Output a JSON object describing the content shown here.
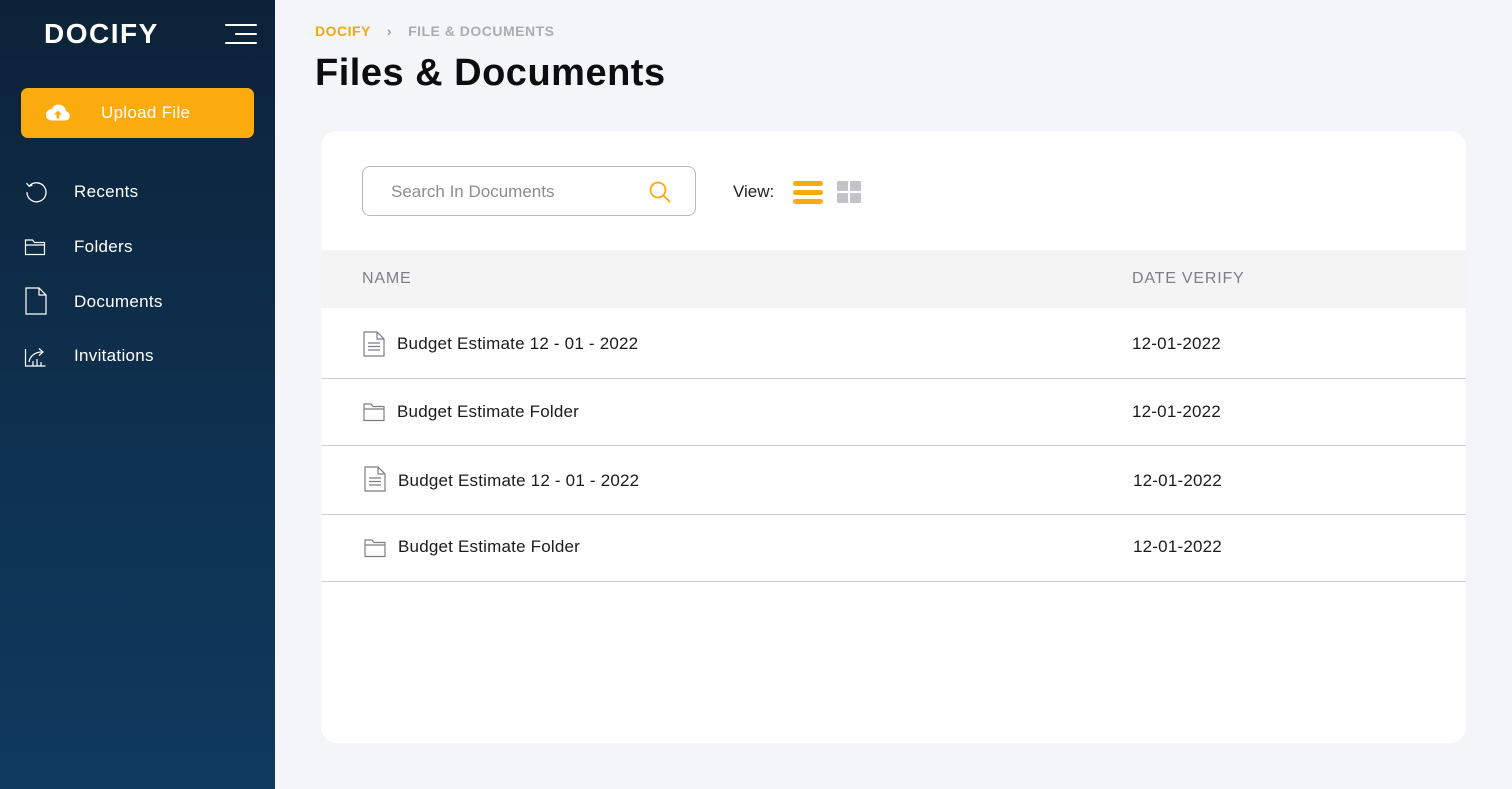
{
  "sidebar": {
    "logo": "DOCIFY",
    "upload_label": "Upload File",
    "items": [
      {
        "label": "Recents",
        "icon": "history-icon"
      },
      {
        "label": "Folders",
        "icon": "folder-icon"
      },
      {
        "label": "Documents",
        "icon": "document-icon"
      },
      {
        "label": "Invitations",
        "icon": "share-icon"
      }
    ]
  },
  "breadcrumb": {
    "home": "DOCIFY",
    "separator": "›",
    "current": "FILE & DOCUMENTS"
  },
  "page_title": "Files & Documents",
  "toolbar": {
    "search_placeholder": "Search In Documents",
    "view_label": "View:",
    "active_view": "list"
  },
  "table": {
    "columns": [
      "NAME",
      "DATE VERIFY"
    ],
    "rows": [
      {
        "type": "file",
        "icon": "file-icon",
        "name": "Budget Estimate 12 - 01 - 2022",
        "date": "12-01-2022"
      },
      {
        "type": "folder",
        "icon": "folder-icon",
        "name": "Budget Estimate Folder",
        "date": "12-01-2022"
      },
      {
        "type": "file",
        "icon": "file-icon",
        "name": "Budget Estimate 12 - 01 - 2022",
        "date": "12-01-2022"
      },
      {
        "type": "folder",
        "icon": "folder-icon",
        "name": "Budget Estimate Folder",
        "date": "12-01-2022"
      }
    ]
  },
  "colors": {
    "accent": "#fcab0e",
    "sidebar_top": "#0c2238",
    "sidebar_bottom": "#0f3a5e",
    "background": "#f4f5f9"
  }
}
